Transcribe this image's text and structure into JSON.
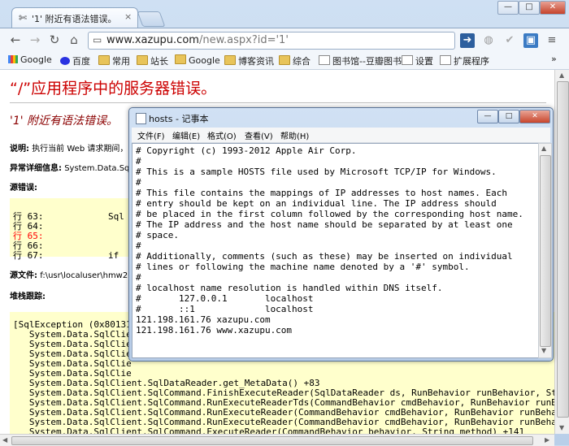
{
  "browser": {
    "tab_icon": "puzzle-icon",
    "tab_title": "'1' 附近有语法错误。",
    "tab_close": "×",
    "window_buttons": [
      "—",
      "□",
      "✕"
    ],
    "nav": {
      "back": "←",
      "forward": "→",
      "reload": "↻",
      "home": "⌂"
    },
    "url_host": "www.xazupu.com",
    "url_path": "/new.aspx?id='1'",
    "right_icons": [
      "share-icon",
      "globe-icon",
      "check-icon",
      "extension-icon",
      "menu-icon"
    ]
  },
  "bookmarks": [
    {
      "label": "Google",
      "kind": "google"
    },
    {
      "label": "百度",
      "kind": "baidu"
    },
    {
      "label": "常用",
      "kind": "folder"
    },
    {
      "label": "站长",
      "kind": "folder"
    },
    {
      "label": "Google",
      "kind": "folder"
    },
    {
      "label": "博客资讯",
      "kind": "folder"
    },
    {
      "label": "综合",
      "kind": "folder"
    },
    {
      "label": "图书馆--豆瓣图书",
      "kind": "page"
    },
    {
      "label": "设置",
      "kind": "page"
    },
    {
      "label": "扩展程序",
      "kind": "page"
    }
  ],
  "bookmarks_overflow": "»",
  "page": {
    "title": "“/”应用程序中的服务器错误。",
    "subtitle": "'1' 附近有语法错误。",
    "desc_label": "说明:",
    "desc_text": "执行当前 Web 请求期间，",
    "exception_label": "异常详细信息:",
    "exception_text": "System.Data.Sql",
    "source_error_label": "源错误:",
    "source_lines": [
      {
        "text": "行 63:            Sql",
        "highlight": false
      },
      {
        "text": "行 64:",
        "highlight": false
      },
      {
        "text": "行 65:",
        "highlight": true
      },
      {
        "text": "行 66:",
        "highlight": false
      },
      {
        "text": "行 67:            if",
        "highlight": false
      }
    ],
    "source_file_label": "源文件:",
    "source_file_text": "f:\\usr\\localuser\\hmw201",
    "stack_label": "堆栈跟踪:",
    "stack_lines": [
      "[SqlException (0x80131",
      "   System.Data.SqlClie",
      "   System.Data.SqlClie",
      "   System.Data.SqlClie",
      "   System.Data.SqlClie",
      "   System.Data.SqlClie",
      "   System.Data.SqlClient.SqlDataReader.get_MetaData() +83",
      "   System.Data.SqlClient.SqlCommand.FinishExecuteReader(SqlDataReader ds, RunBehavior runBehavior, Str",
      "   System.Data.SqlClient.SqlCommand.RunExecuteReaderTds(CommandBehavior cmdBehavior, RunBehavior runBe",
      "   System.Data.SqlClient.SqlCommand.RunExecuteReader(CommandBehavior cmdBehavior, RunBehavior runBehav",
      "   System.Data.SqlClient.SqlCommand.RunExecuteReader(CommandBehavior cmdBehavior, RunBehavior runBehav",
      "   System.Data.SqlClient.SqlCommand.ExecuteReader(CommandBehavior behavior, String method) +141"
    ]
  },
  "notepad": {
    "title": "hosts - 记事本",
    "buttons": [
      "—",
      "□",
      "✕"
    ],
    "menu": [
      "文件(F)",
      "编辑(E)",
      "格式(O)",
      "查看(V)",
      "帮助(H)"
    ],
    "lines": [
      "# Copyright (c) 1993-2012 Apple Air Corp.",
      "#",
      "# This is a sample HOSTS file used by Microsoft TCP/IP for Windows.",
      "#",
      "# This file contains the mappings of IP addresses to host names. Each",
      "# entry should be kept on an individual line. The IP address should",
      "# be placed in the first column followed by the corresponding host name.",
      "# The IP address and the host name should be separated by at least one",
      "# space.",
      "#",
      "# Additionally, comments (such as these) may be inserted on individual",
      "# lines or following the machine name denoted by a '#' symbol.",
      "#",
      "# localhost name resolution is handled within DNS itself.",
      "#       127.0.0.1       localhost",
      "#       ::1             localhost",
      "121.198.161.76 xazupu.com",
      "121.198.161.76 www.xazupu.com"
    ]
  },
  "colors": {
    "error_red": "#cc0000",
    "source_bg": "#ffffcc",
    "highlight_line": "#ff0000"
  }
}
